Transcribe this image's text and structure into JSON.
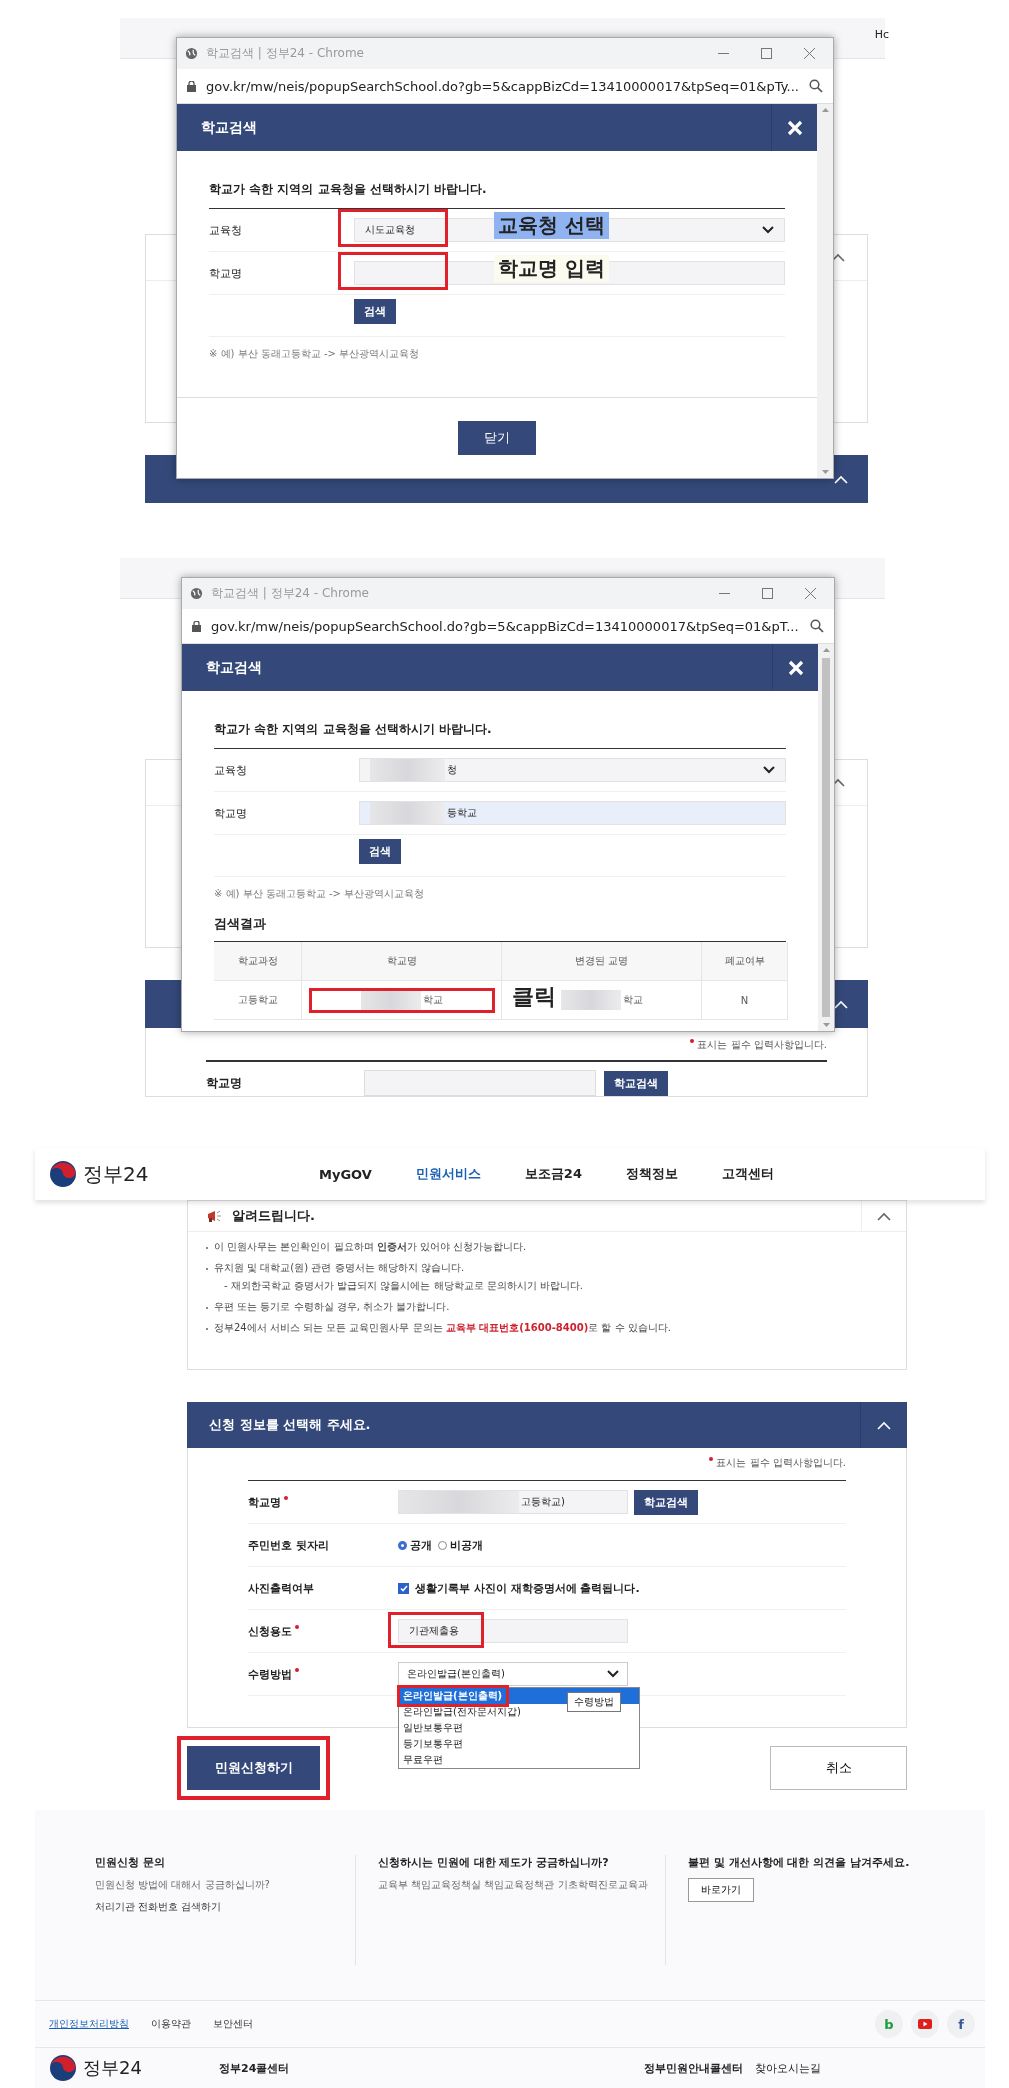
{
  "step1": {
    "background": {
      "corner_text": "Hc"
    },
    "popup": {
      "window_title": "학교검색 | 정부24 - Chrome",
      "url": "gov.kr/mw/neis/popupSearchSchool.do?gb=5&cappBizCd=13410000017&tpSeq=01&pTy...",
      "dialog_title": "학교검색",
      "instruction": "학교가 속한 지역의 교육청을 선택하시기 바랍니다.",
      "fields": [
        {
          "label": "교육청",
          "kind": "select",
          "value": "시도교육청",
          "annotated": true,
          "callout": "교육청 선택"
        },
        {
          "label": "학교명",
          "kind": "input",
          "annotated": true,
          "callout": "학교명 입력"
        }
      ],
      "search_button": "검색",
      "example": "※ 예) 부산 동래고등학교 -> 부산광역시교육청",
      "close_button": "닫기"
    }
  },
  "step2": {
    "background": {
      "required_note": "표시는 필수 입력사항입니다.",
      "field_label": "학교명",
      "search_button": "학교검색"
    },
    "popup": {
      "window_title": "학교검색 | 정부24 - Chrome",
      "url": "gov.kr/mw/neis/popupSearchSchool.do?gb=5&cappBizCd=13410000017&tpSeq=01&pT...",
      "dialog_title": "학교검색",
      "instruction": "학교가 속한 지역의 교육청을 선택하시기 바랍니다.",
      "fields": [
        {
          "label": "교육청",
          "kind": "select",
          "value": "청",
          "redacted": true
        },
        {
          "label": "학교명",
          "kind": "input",
          "value": "등학교",
          "redacted": true
        }
      ],
      "search_button": "검색",
      "example": "※ 예) 부산 동래고등학교 -> 부산광역시교육청",
      "results": {
        "title": "검색결과",
        "columns": [
          "학교과정",
          "학교명",
          "변경된 교명",
          "폐교여부"
        ],
        "rows": [
          {
            "cells": [
              {
                "text": "고등학교"
              },
              {
                "text": "학교",
                "redacted": true,
                "annotated": true
              },
              {
                "text": "학교",
                "redacted": true
              },
              {
                "text": "N"
              }
            ]
          }
        ],
        "callout": "클릭"
      }
    }
  },
  "step3": {
    "logo": "정부24",
    "nav": [
      {
        "label": "MyGOV",
        "selected": false
      },
      {
        "label": "민원서비스",
        "selected": true
      },
      {
        "label": "보조금24",
        "selected": false
      },
      {
        "label": "정책정보",
        "selected": false
      },
      {
        "label": "고객센터",
        "selected": false
      }
    ],
    "notice": {
      "title": "알려드립니다.",
      "items": [
        {
          "text": "이 민원사무는 본인확인이 필요하며 **인증서**가 있어야 신청가능합니다."
        },
        {
          "text": "유치원 및 대학교(원) 관련 증명서는 해당하지 않습니다.",
          "sub": "- 재외한국학교 증명서가 발급되지 않을시에는 해당학교로 문의하시기 바랍니다."
        },
        {
          "text": "우편 또는 등기로 수령하실 경우, 취소가 불가합니다."
        },
        {
          "text": "정부24에서 서비스 되는 모든 교육민원사무 문의는 ",
          "emphasis": "교육부 대표번호(1600-8400)",
          "text_after": "로 할 수 있습니다."
        }
      ]
    },
    "form": {
      "title": "신청 정보를 선택해 주세요.",
      "required_note": "표시는 필수 입력사항입니다.",
      "rows": [
        {
          "label": "학교명",
          "required": true,
          "kind": "school",
          "value": "고등학교)",
          "redacted": true,
          "button": "학교검색"
        },
        {
          "label": "주민번호 뒷자리",
          "kind": "radio",
          "options": [
            {
              "label": "공개",
              "selected": true
            },
            {
              "label": "비공개",
              "selected": false
            }
          ]
        },
        {
          "label": "사진출력여부",
          "kind": "checkbox",
          "checked": true,
          "text": "생활기록부 사진이 재학증명서에 출력됩니다."
        },
        {
          "label": "신청용도",
          "required": true,
          "kind": "input",
          "value": "기관제출용",
          "annotated": true
        },
        {
          "label": "수령방법",
          "required": true,
          "kind": "select",
          "value": "온라인발급(본인출력)",
          "tooltip": "수령방법",
          "options": [
            {
              "label": "온라인발급(본인출력)",
              "selected": true,
              "annotated": true
            },
            {
              "label": "온라인발급(전자문서지갑)",
              "selected": false
            },
            {
              "label": "일반보통우편",
              "selected": false
            },
            {
              "label": "등기보통우편",
              "selected": false
            },
            {
              "label": "무료우편",
              "selected": false
            }
          ]
        }
      ],
      "submit_button": {
        "label": "민원신청하기",
        "annotated": true
      },
      "cancel_button": "취소"
    },
    "info": [
      {
        "title": "민원신청 문의",
        "lines": [
          "민원신청 방법에 대해서 궁금하십니까?",
          "처리기관 전화번호 검색하기"
        ]
      },
      {
        "title": "신청하시는 민원에 대한 제도가 궁금하십니까?",
        "lines": [
          "교육부 책임교육정책실 책임교육정책관 기초학력진로교육과"
        ]
      },
      {
        "title": "불편 및 개선사항에 대한 의견을 남겨주세요.",
        "button": "바로가기"
      }
    ],
    "footer_links": [
      {
        "label": "개인정보처리방침",
        "highlight": true
      },
      {
        "label": "이용약관",
        "highlight": false
      },
      {
        "label": "보안센터",
        "highlight": false
      }
    ],
    "social": [
      {
        "kind": "blog",
        "label": "b"
      },
      {
        "kind": "youtube"
      },
      {
        "kind": "facebook",
        "label": "f"
      }
    ],
    "bottom": {
      "logo": "정부24",
      "items": [
        "정부24콜센터",
        "정부민원안내콜센터",
        "찾아오시는길"
      ]
    }
  }
}
